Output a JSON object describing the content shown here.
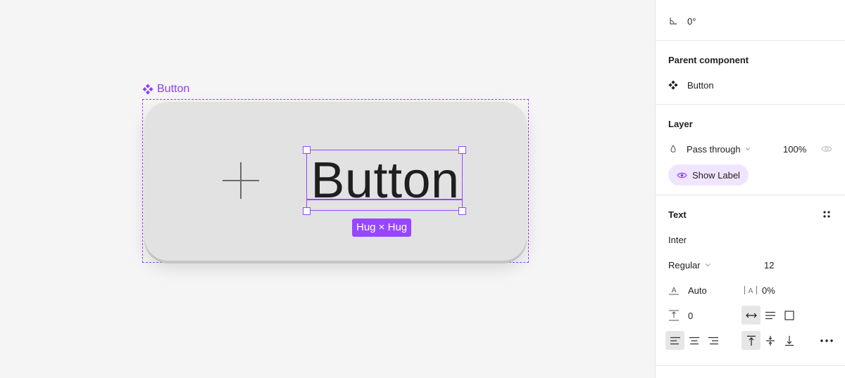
{
  "canvas": {
    "component_label": "Button",
    "button_text": "Button",
    "size_label": "Hug × Hug"
  },
  "panel": {
    "rotation": {
      "icon": "angle-icon",
      "value": "0°"
    },
    "parent_component": {
      "title": "Parent component",
      "icon": "component-icon",
      "name": "Button"
    },
    "layer": {
      "title": "Layer",
      "blend_mode": "Pass through",
      "opacity": "100%",
      "show_label": "Show Label"
    },
    "text": {
      "title": "Text",
      "font_family": "Inter",
      "font_style": "Regular",
      "font_size": "12",
      "line_height": "Auto",
      "letter_spacing": "0%",
      "paragraph_spacing": "0"
    }
  },
  "colors": {
    "accent": "#9747ff",
    "canvas_bg": "#f5f5f5",
    "panel_bg": "#ffffff"
  }
}
